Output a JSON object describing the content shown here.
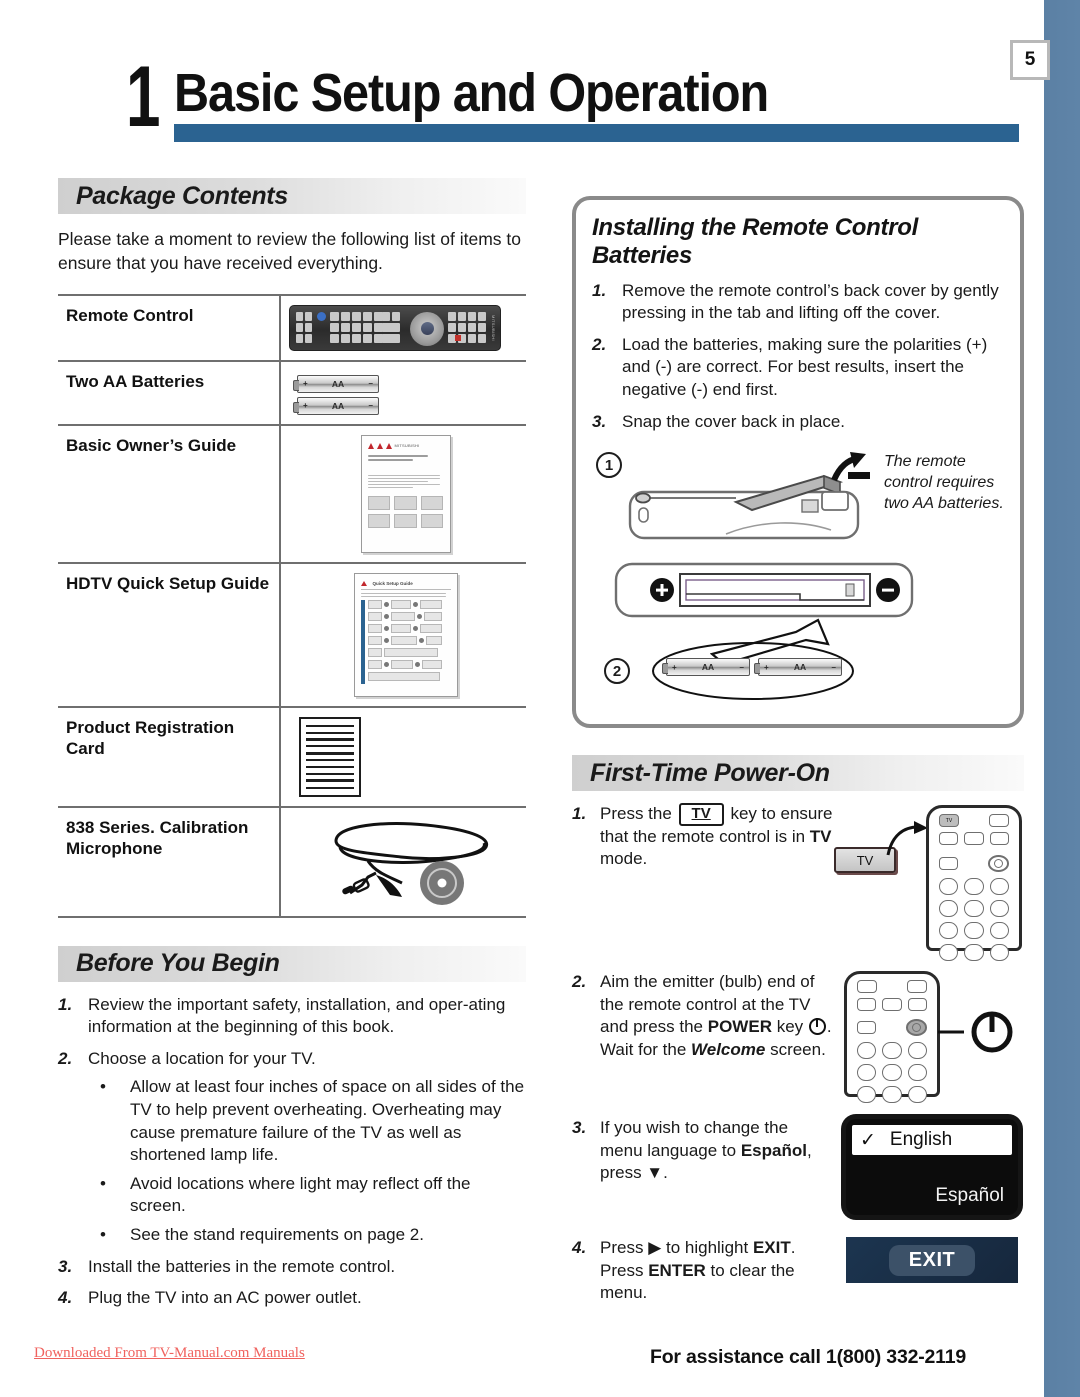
{
  "page": {
    "number": "5",
    "chapter_number": "1",
    "chapter_title": "Basic Setup and Operation",
    "accent_color": "#2b6391",
    "edge_bar_color": "#5d82a6"
  },
  "package_contents": {
    "heading": "Package Contents",
    "intro": "Please take a moment to review the following list of items to ensure that you have received everything.",
    "rows": [
      {
        "label": "Remote Control",
        "art": "remote-control-illustration"
      },
      {
        "label": "Two AA Batteries",
        "art": "two-aa-batteries-illustration",
        "battery_label": "AA",
        "battery_plus": "+",
        "battery_minus": "–"
      },
      {
        "label": "Basic Owner’s Guide",
        "art": "owners-guide-booklet-illustration"
      },
      {
        "label": "HDTV Quick Setup Guide",
        "art": "quick-setup-guide-sheet-illustration",
        "sheet_title": "Quick Setup Guide"
      },
      {
        "label": "Product Registration Card",
        "art": "registration-card-illustration"
      },
      {
        "label": "838 Series.  Calibration Microphone",
        "art": "calibration-microphone-illustration"
      }
    ]
  },
  "before_you_begin": {
    "heading": "Before You Begin",
    "steps": [
      {
        "n": "1.",
        "text": "Review the important safety, installation, and oper-ating information at the beginning of this book."
      },
      {
        "n": "2.",
        "text": "Choose a location for your TV.",
        "bullets": [
          "Allow at least four inches of space on all sides of the TV to help prevent overheating.  Overheating may cause premature failure of the TV as well as shortened lamp life.",
          "Avoid locations where light may reflect off the screen.",
          "See the stand requirements on page 2."
        ]
      },
      {
        "n": "3.",
        "text": "Install the batteries in the remote control."
      },
      {
        "n": "4.",
        "text": "Plug the TV into an AC power outlet."
      }
    ]
  },
  "installing_batteries": {
    "heading": "Installing the Remote Control Batteries",
    "steps": [
      {
        "n": "1.",
        "text": "Remove the remote control’s back cover by gently pressing in the tab and lifting off the cover."
      },
      {
        "n": "2.",
        "text": "Load the batteries, making sure the polarities (+) and (-) are correct.  For best results, insert the negative (-) end first."
      },
      {
        "n": "3.",
        "text": "Snap the cover back in place."
      }
    ],
    "diagram": {
      "callout_1": "1",
      "callout_2": "2",
      "note": "The remote control requires two AA batteries.",
      "polarity_plus": "+",
      "polarity_minus": "–",
      "battery_label": "AA"
    }
  },
  "first_time_power_on": {
    "heading": "First-Time Power-On",
    "steps": [
      {
        "n": "1.",
        "parts": [
          {
            "t": "Press the "
          },
          {
            "t": "TV",
            "style": "key"
          },
          {
            "t": " key to ensure that the remote control is in "
          },
          {
            "t": "TV",
            "style": "bold"
          },
          {
            "t": " mode."
          }
        ],
        "art": {
          "name": "remote-top-with-tv-key",
          "callout_label": "TV",
          "key_label": "TV"
        }
      },
      {
        "n": "2.",
        "parts": [
          {
            "t": "Aim the emitter (bulb) end of the remote control at the TV and press the "
          },
          {
            "t": "POWER",
            "style": "bold"
          },
          {
            "t": " key "
          },
          {
            "t": "⏻",
            "style": "power-icon"
          },
          {
            "t": ".  Wait for the "
          },
          {
            "t": "Welcome",
            "style": "bold-italic"
          },
          {
            "t": " screen."
          }
        ],
        "art": {
          "name": "remote-with-power-key"
        }
      },
      {
        "n": "3.",
        "parts": [
          {
            "t": "If you wish to change the menu language to "
          },
          {
            "t": "Español",
            "style": "bold"
          },
          {
            "t": ", press "
          },
          {
            "t": "▼",
            "style": "glyph"
          },
          {
            "t": "."
          }
        ],
        "art": {
          "name": "language-menu",
          "selected": "English",
          "check": "✓",
          "other": "Español"
        }
      },
      {
        "n": "4.",
        "parts": [
          {
            "t": "Press "
          },
          {
            "t": "▶",
            "style": "glyph"
          },
          {
            "t": " to highlight "
          },
          {
            "t": "EXIT",
            "style": "bold"
          },
          {
            "t": ".  Press "
          },
          {
            "t": "ENTER",
            "style": "bold"
          },
          {
            "t": " to clear the menu."
          }
        ],
        "art": {
          "name": "exit-button-panel",
          "label": "EXIT"
        }
      }
    ]
  },
  "footer": {
    "left": "Downloaded From TV-Manual.com Manuals",
    "right": "For assistance call 1(800) 332-2119"
  }
}
